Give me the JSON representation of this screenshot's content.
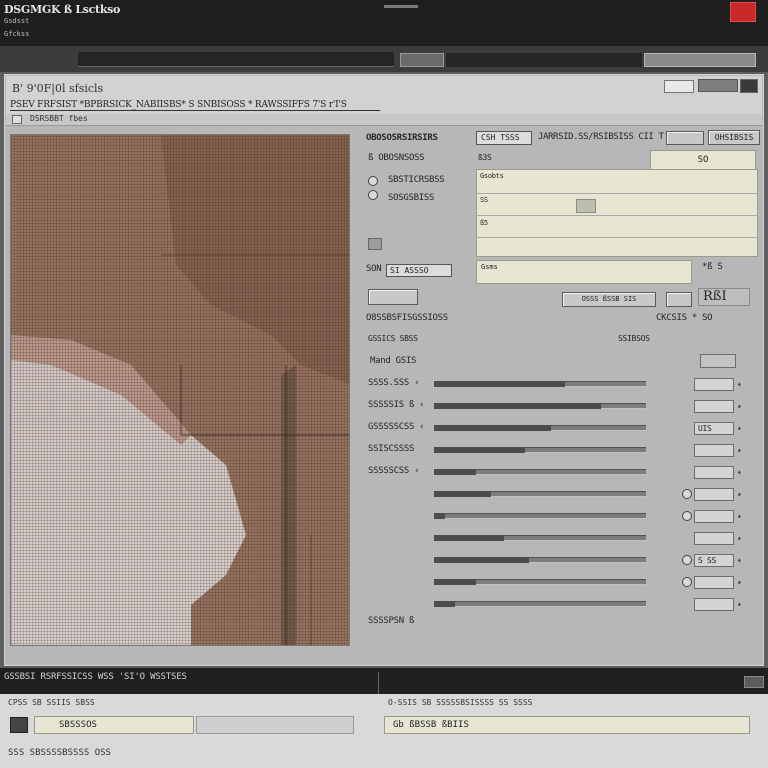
{
  "titlebar": {
    "app_title": "DSGMGK ß Lsctkso",
    "sub1": "Gsdsst",
    "sub2": "Gfckss"
  },
  "window": {
    "title": "B' 9'0F|0l sfsicls",
    "path": "PSEV FRFSIST *BPBRSICK_NABIISBS* S SNBISOSS * RAWSSIFFS 7'S r'I'S",
    "subtoolbar": "DSRSBBT fbes"
  },
  "settings": {
    "heading": "OBOSOSRSIRSIRS",
    "dropdown_a": "CSH TSSS",
    "heading_2": "JARRSID.SS/RSIBSISS CII T'RCSIS",
    "btn_top_right": "OHSIBSIS",
    "row_size_label": "ß OBOSNSOSS",
    "row_size_val": "ß3S",
    "top_value": "SO",
    "big_field_t1": "Gsobts",
    "big_field_t2": "SS",
    "big_field_t3": "ß5",
    "radio_1_label": "SBSTICRSBSS",
    "radio_2_label": "SOSGSBISS",
    "crop_label": "SON",
    "crop_field": "SI ASSSO",
    "mid_field": "Gsms",
    "mid_right_label": "*ß  S",
    "btn_row_b": "OSSS ßSSB SIS",
    "btn_row_d": "RßI",
    "sec2_heading": "O8SSBSFISGSSIOSS",
    "sec2_right": "CKCSIS * SO",
    "sec2_sub_left": "GSSICS SBSS",
    "sec2_sub_right": "SSIBSOS",
    "sec2_line3": "Mand GSIS",
    "slider_rows": [
      {
        "label": "SSSS.SSS ‹",
        "fill": 0.62,
        "spin": "",
        "checkbox": false
      },
      {
        "label": "SSSSSIS ß ‹",
        "fill": 0.79,
        "spin": "",
        "checkbox": false
      },
      {
        "label": "GSSSSSCSS ‹",
        "fill": 0.55,
        "spin": "UIS",
        "checkbox": false
      },
      {
        "label": "SSISCSSSS",
        "fill": 0.43,
        "spin": "",
        "checkbox": false
      },
      {
        "label": "SSSSSCSS ‹",
        "fill": 0.2,
        "spin": "",
        "checkbox": false
      },
      {
        "label": "",
        "fill": 0.27,
        "spin": "",
        "checkbox": true
      },
      {
        "label": "",
        "fill": 0.05,
        "spin": "",
        "checkbox": true
      },
      {
        "label": "",
        "fill": 0.33,
        "spin": "",
        "checkbox": false
      },
      {
        "label": "",
        "fill": 0.45,
        "spin": "S SS",
        "checkbox": true
      },
      {
        "label": "",
        "fill": 0.2,
        "spin": "",
        "checkbox": true
      },
      {
        "label": "",
        "fill": 0.1,
        "spin": "",
        "checkbox": false
      }
    ],
    "last_label": "SSSSPSN ß"
  },
  "footer": {
    "title": "GSSBSI RSRFSSICSS WSS 'SI'O WSSTSES",
    "hint_left": "CPSS SB SSIIS SBSS",
    "hint_right": "O-SSIS SB SSSSSBSISSSS SS SSSS",
    "field_left": "SBSSSOS",
    "field_right": "Gb ßBSSB ßBIIS",
    "status": "SSS SBSSSSBSSSS OSS"
  },
  "colors": {
    "close": "#c82828",
    "field": "#e6e6d3",
    "preview_tint": "#8a5a44"
  }
}
